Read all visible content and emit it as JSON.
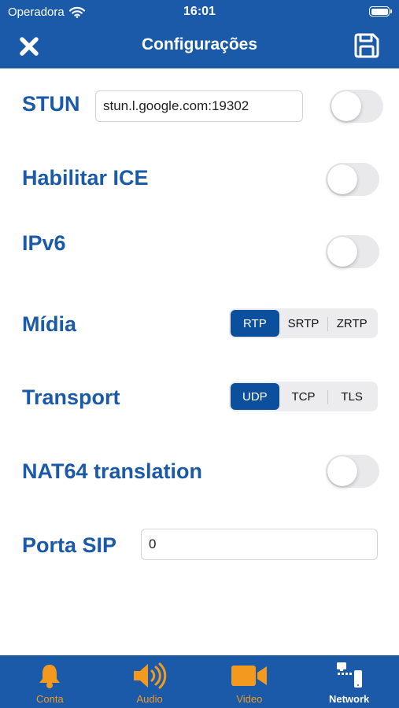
{
  "status_bar": {
    "carrier": "Operadora",
    "time": "16:01"
  },
  "nav": {
    "title": "Configurações",
    "close_icon": "close-x-icon",
    "save_icon": "floppy-disk-icon"
  },
  "settings": {
    "stun": {
      "label": "STUN",
      "value": "stun.l.google.com:19302",
      "enabled": false
    },
    "ice": {
      "label": "Habilitar ICE",
      "enabled": false
    },
    "ipv6": {
      "label": "IPv6",
      "enabled": false
    },
    "media": {
      "label": "Mídia",
      "options": [
        "RTP",
        "SRTP",
        "ZRTP"
      ],
      "selected": "RTP"
    },
    "transport": {
      "label": "Transport",
      "options": [
        "UDP",
        "TCP",
        "TLS"
      ],
      "selected": "UDP"
    },
    "nat64": {
      "label": "NAT64 translation",
      "enabled": false
    },
    "sip_port": {
      "label": "Porta SIP",
      "value": "0"
    }
  },
  "tabs": [
    {
      "label": "Conta",
      "icon": "bell-icon",
      "active": false
    },
    {
      "label": "Audio",
      "icon": "speaker-icon",
      "active": false
    },
    {
      "label": "Video",
      "icon": "video-camera-icon",
      "active": false
    },
    {
      "label": "Network",
      "icon": "network-icon",
      "active": true
    }
  ],
  "colors": {
    "brand_blue": "#1a5aa8",
    "segment_selected": "#0c4f9c",
    "tab_icon_orange": "#f39a1e"
  }
}
